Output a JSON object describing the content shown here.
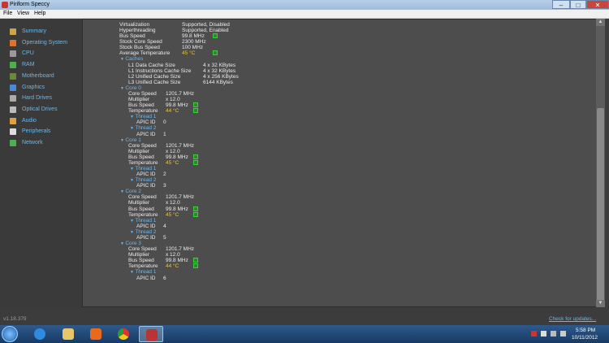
{
  "window": {
    "title": "Piriform Speccy",
    "min_glyph": "–",
    "max_glyph": "□",
    "close_glyph": "✕"
  },
  "menu": [
    "File",
    "View",
    "Help"
  ],
  "sidebar": [
    {
      "label": "Summary",
      "icon": "summary-icon",
      "color": "#c9a64a"
    },
    {
      "label": "Operating System",
      "icon": "windows-logo-icon",
      "color": "#e0712a"
    },
    {
      "label": "CPU",
      "icon": "cpu-icon",
      "color": "#9a9a9a"
    },
    {
      "label": "RAM",
      "icon": "ram-icon",
      "color": "#4caf50"
    },
    {
      "label": "Motherboard",
      "icon": "motherboard-icon",
      "color": "#6a8a3a"
    },
    {
      "label": "Graphics",
      "icon": "graphics-icon",
      "color": "#4a8ad4"
    },
    {
      "label": "Hard Drives",
      "icon": "hard-drive-icon",
      "color": "#aaaaaa"
    },
    {
      "label": "Optical Drives",
      "icon": "optical-drive-icon",
      "color": "#bbbbbb"
    },
    {
      "label": "Audio",
      "icon": "audio-icon",
      "color": "#e0a040"
    },
    {
      "label": "Peripherals",
      "icon": "peripherals-icon",
      "color": "#dddddd"
    },
    {
      "label": "Network",
      "icon": "network-icon",
      "color": "#4caf50"
    }
  ],
  "content": {
    "top": [
      {
        "k": "Virtualization",
        "v": "Supported, Disabled"
      },
      {
        "k": "Hyperthreading",
        "v": "Supported, Enabled"
      },
      {
        "k": "Bus Speed",
        "v": "99.8 MHz"
      },
      {
        "k": "Stock Core Speed",
        "v": "2300 MHz"
      },
      {
        "k": "Stock Bus Speed",
        "v": "100 MHz"
      },
      {
        "k": "Average Temperature",
        "v": "45 °C"
      }
    ],
    "caches_label": "Caches",
    "caches": [
      {
        "k": "L1 Data Cache Size",
        "v": "4 x 32 KBytes"
      },
      {
        "k": "L1 Instructions Cache Size",
        "v": "4 x 32 KBytes"
      },
      {
        "k": "L2 Unified Cache Size",
        "v": "4 x 256 KBytes"
      },
      {
        "k": "L3 Unified Cache Size",
        "v": "6144 KBytes"
      }
    ],
    "cores": [
      {
        "label": "Core 0",
        "speed": "1201.7 MHz",
        "mult": "x 12.0",
        "bus": "99.8 MHz",
        "temp": "44 °C",
        "threads": [
          {
            "label": "Thread 1",
            "apic": "0"
          },
          {
            "label": "Thread 2",
            "apic": "1"
          }
        ]
      },
      {
        "label": "Core 1",
        "speed": "1201.7 MHz",
        "mult": "x 12.0",
        "bus": "99.8 MHz",
        "temp": "45 °C",
        "threads": [
          {
            "label": "Thread 1",
            "apic": "2"
          },
          {
            "label": "Thread 2",
            "apic": "3"
          }
        ]
      },
      {
        "label": "Core 2",
        "speed": "1201.7 MHz",
        "mult": "x 12.0",
        "bus": "99.8 MHz",
        "temp": "45 °C",
        "threads": [
          {
            "label": "Thread 1",
            "apic": "4"
          },
          {
            "label": "Thread 2",
            "apic": "5"
          }
        ]
      },
      {
        "label": "Core 3",
        "speed": "1201.7 MHz",
        "mult": "x 12.0",
        "bus": "99.8 MHz",
        "temp": "44 °C",
        "threads": [
          {
            "label": "Thread 1",
            "apic": "6"
          }
        ]
      }
    ],
    "labels": {
      "core_speed": "Core Speed",
      "multiplier": "Multiplier",
      "bus_speed": "Bus Speed",
      "temperature": "Temperature",
      "apic_id": "APIC ID"
    }
  },
  "status": {
    "version": "v1.18.379",
    "update": "Check for updates..."
  },
  "clock": {
    "time": "5:58 PM",
    "date": "10/11/2012"
  },
  "colors": {
    "accent": "#6fb6e4",
    "temp": "#e8c14a",
    "gauge": "#3cd13c"
  }
}
